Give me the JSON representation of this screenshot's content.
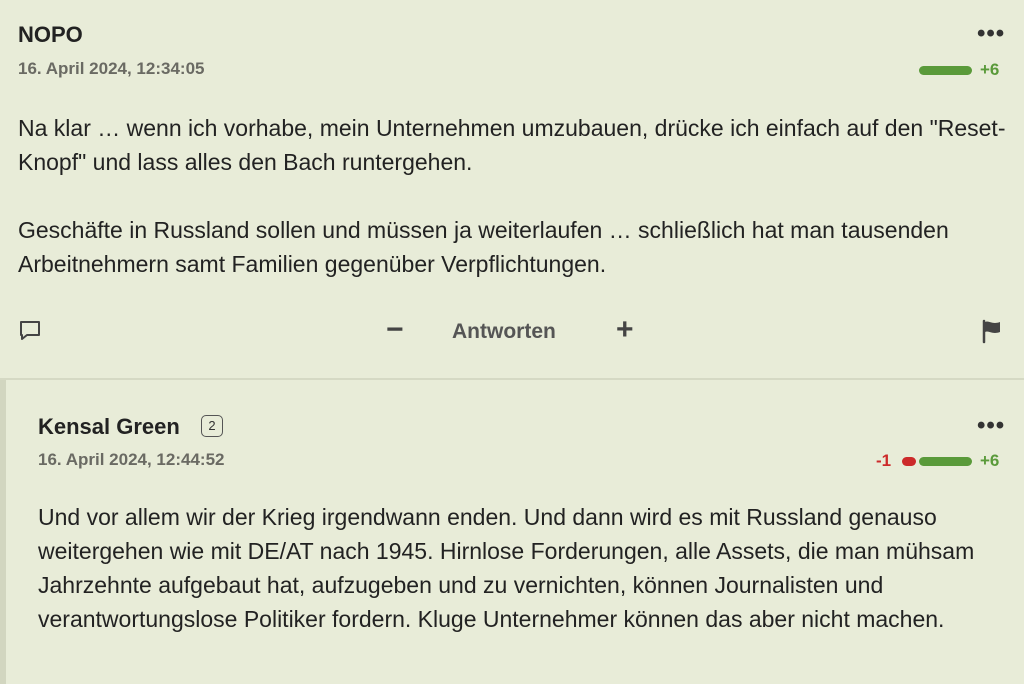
{
  "post": {
    "author": "NOPO",
    "date": "16. April 2024, 12:34:05",
    "menu": "•••",
    "vote_positive": "+6",
    "paragraphs": [
      "Na klar … wenn ich vorhabe, mein Unternehmen umzubauen, drücke ich einfach auf den \"Reset-Knopf\" und lass alles den Bach runtergehen.",
      "Geschäfte in Russland sollen und müssen ja weiterlaufen … schließlich hat man tausenden Arbeitnehmern samt Familien gegenüber Verpflichtungen."
    ],
    "actions": {
      "minus": "−",
      "reply": "Antworten",
      "plus": "+"
    }
  },
  "reply": {
    "author": "Kensal Green",
    "badge": "2",
    "date": "16. April 2024, 12:44:52",
    "menu": "•••",
    "vote_negative": "-1",
    "vote_positive": "+6",
    "text": "Und vor allem wir der Krieg irgendwann enden. Und dann wird es mit Russland genauso weitergehen wie mit DE/AT nach 1945. Hirnlose Forderungen, alle Assets, die man mühsam Jahrzehnte aufgebaut hat, aufzugeben und zu vernichten, können Journalisten und verantwortungslose Politiker fordern. Kluge Unternehmer können das aber nicht machen."
  },
  "icons": {
    "comment": "comment-icon",
    "flag": "flag-icon",
    "menu": "more-icon"
  },
  "colors": {
    "background": "#e8ecd8",
    "positive": "#5a9a3a",
    "negative": "#cc2a2a"
  }
}
